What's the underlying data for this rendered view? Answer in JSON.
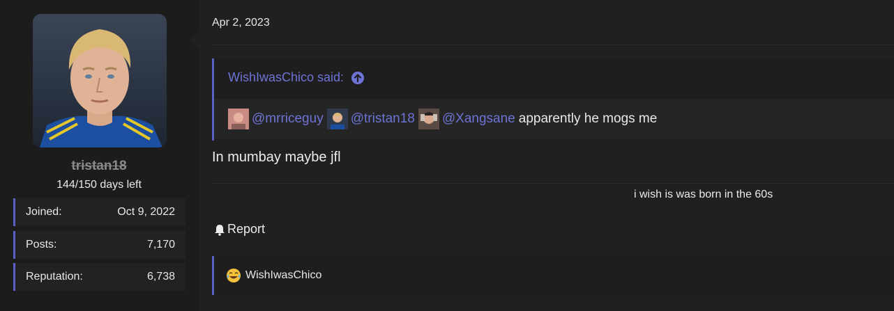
{
  "user": {
    "name": "tristan18",
    "title": "144/150 days left",
    "avatar_icon": "user-avatar-photo",
    "stats": [
      {
        "label": "Joined:",
        "value": "Oct 9, 2022"
      },
      {
        "label": "Posts:",
        "value": "7,170"
      },
      {
        "label": "Reputation:",
        "value": "6,738"
      }
    ]
  },
  "post": {
    "date": "Apr 2, 2023",
    "quote": {
      "author_line": "WishIwasChico said:",
      "up_icon": "arrow-circle-up-icon",
      "mentions": [
        "@mrriceguy",
        "@tristan18",
        "@Xangsane"
      ],
      "text": "apparently he mogs me"
    },
    "message": "In mumbay maybe jfl",
    "signature": "i wish is was born in the 60s",
    "report_label": "Report",
    "reaction": {
      "icon": "laughing-crying-emoji-icon",
      "user": "WishIwasChico"
    }
  },
  "colors": {
    "accent": "#5b5fc7",
    "link": "#6e73d6",
    "background": "#202020"
  }
}
